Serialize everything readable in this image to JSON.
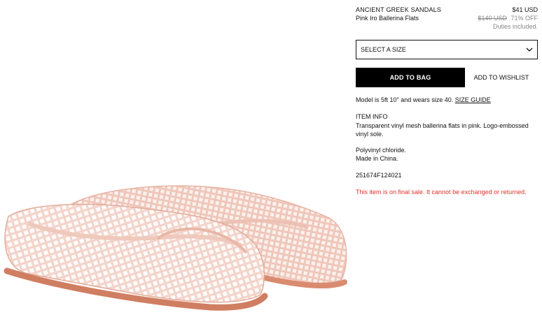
{
  "product": {
    "brand": "ANCIENT GREEK SANDALS",
    "name": "Pink Iro Ballerina Flats",
    "price": "$41 USD",
    "original_price": "$140 USD",
    "discount": "71% OFF",
    "duties_note": "Duties included."
  },
  "size_select": {
    "label": "SELECT A SIZE",
    "icon": "chevron-down-icon"
  },
  "actions": {
    "add_to_bag": "ADD TO BAG",
    "add_to_wishlist": "ADD TO WISHLIST"
  },
  "model_info": {
    "text": "Model is 5ft 10\" and wears size 40.",
    "size_guide_link": "SIZE GUIDE"
  },
  "item_info": {
    "heading": "ITEM INFO",
    "description": "Transparent vinyl mesh ballerina flats in pink. Logo-embossed vinyl sole.",
    "material": "Polyvinyl chloride.",
    "origin": "Made in China.",
    "sku": "251674F124021"
  },
  "notice": {
    "final_sale": "This item is on final sale. It cannot be exchanged or returned.",
    "color": "#e0322a"
  },
  "colors": {
    "button_bg": "#000000",
    "muted_text": "#888888"
  }
}
